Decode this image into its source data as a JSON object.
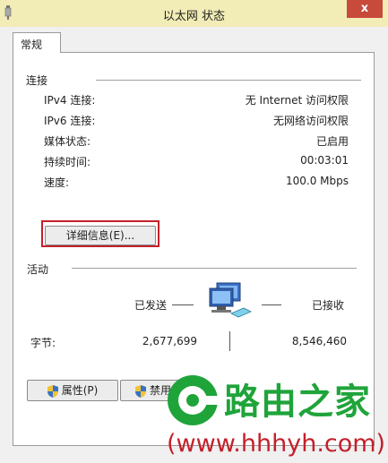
{
  "window": {
    "title": "以太网 状态",
    "close_glyph": "x"
  },
  "tabs": [
    {
      "label": "常规"
    }
  ],
  "connection": {
    "section_title": "连接",
    "rows": [
      {
        "label": "IPv4 连接:",
        "value": "无 Internet 访问权限"
      },
      {
        "label": "IPv6 连接:",
        "value": "无网络访问权限"
      },
      {
        "label": "媒体状态:",
        "value": "已启用"
      },
      {
        "label": "持续时间:",
        "value": "00:03:01"
      },
      {
        "label": "速度:",
        "value": "100.0 Mbps"
      }
    ],
    "details_button": "详细信息(E)..."
  },
  "activity": {
    "section_title": "活动",
    "sent_label": "已发送",
    "received_label": "已接收",
    "bytes_label": "字节:",
    "bytes_sent": "2,677,699",
    "bytes_received": "8,546,460",
    "icon": "network-computers-icon"
  },
  "buttons": {
    "properties": "属性(P)",
    "disable": "禁用"
  },
  "watermark": {
    "logo_text": "路由之家",
    "url": "(www.hhhyh.com)"
  },
  "colors": {
    "highlight": "#c2202a",
    "watermark_green": "#1fa43a",
    "watermark_red": "#c3202a",
    "close": "#c74a3a"
  }
}
